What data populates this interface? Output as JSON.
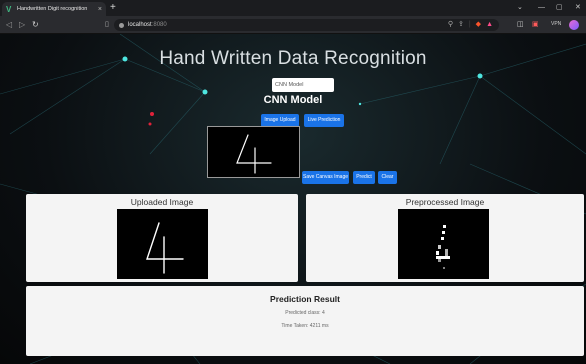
{
  "browser": {
    "tab_title": "Handwritten Digit recognition",
    "tab_close": "×",
    "new_tab": "+",
    "url_host": "localhost",
    "url_port": ":8080",
    "vpn_label": "VPN"
  },
  "page": {
    "title": "Hand Written Data Recognition",
    "model_select_value": "CNN Model",
    "model_heading": "CNN Model",
    "buttons": {
      "image_upload": "Image Upload",
      "live_prediction": "Live Prediction",
      "save_canvas": "Save Canvas Image",
      "predict": "Predict",
      "clear": "Clear"
    },
    "canvas_digit": "4",
    "uploaded": {
      "title": "Uploaded Image"
    },
    "preprocessed": {
      "title": "Preprocessed Image"
    },
    "result": {
      "title": "Prediction Result",
      "predicted_class": "Predicted class: 4",
      "time_taken": "Time Taken: 4211 ms"
    }
  },
  "colors": {
    "button_blue": "#1a73e8",
    "card_bg": "#f4f4f4",
    "background": "#0b0f12"
  }
}
